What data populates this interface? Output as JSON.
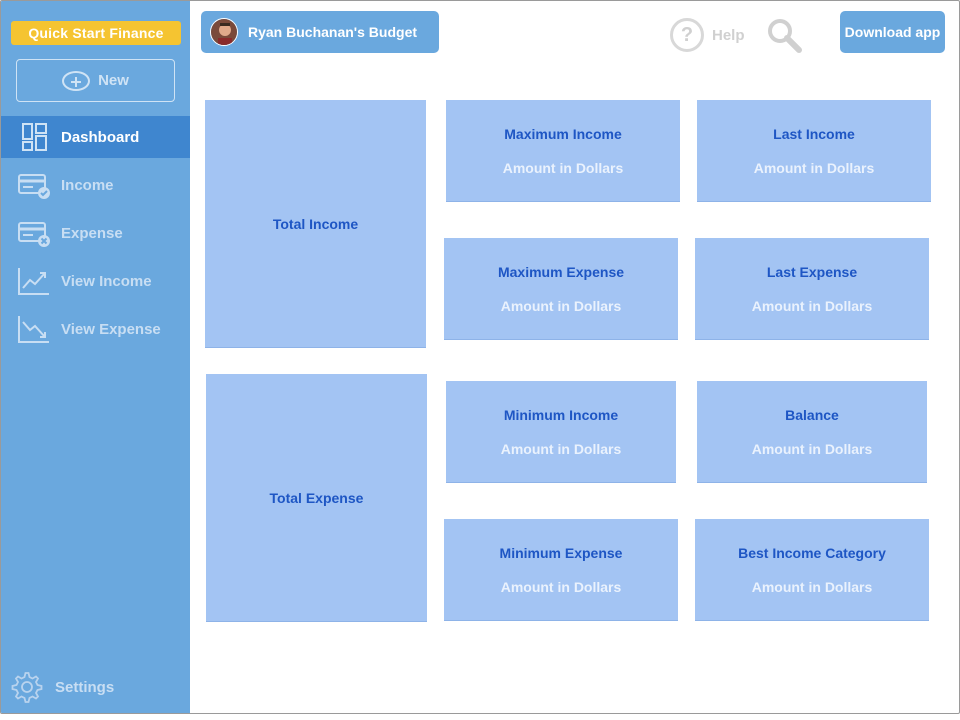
{
  "sidebar": {
    "brand": "Quick Start Finance",
    "new_label": "New",
    "items": [
      {
        "label": "Dashboard",
        "icon": "dashboard-icon"
      },
      {
        "label": "Income",
        "icon": "income-icon"
      },
      {
        "label": "Expense",
        "icon": "expense-icon"
      },
      {
        "label": "View Income",
        "icon": "chart-up-icon"
      },
      {
        "label": "View Expense",
        "icon": "chart-down-icon"
      }
    ],
    "settings_label": "Settings"
  },
  "header": {
    "budget_title": "Ryan Buchanan's Budget",
    "help_label": "Help",
    "download_label": "Download app"
  },
  "cards": {
    "total_income": "Total Income",
    "total_expense": "Total Expense",
    "max_income": {
      "title": "Maximum Income",
      "value": "Amount in Dollars"
    },
    "last_income": {
      "title": "Last Income",
      "value": "Amount in Dollars"
    },
    "max_expense": {
      "title": "Maximum Expense",
      "value": "Amount in Dollars"
    },
    "last_expense": {
      "title": "Last Expense",
      "value": "Amount in Dollars"
    },
    "min_income": {
      "title": "Minimum Income",
      "value": "Amount in Dollars"
    },
    "balance": {
      "title": "Balance",
      "value": "Amount in Dollars"
    },
    "min_expense": {
      "title": "Minimum Expense",
      "value": "Amount in Dollars"
    },
    "best_income_category": {
      "title": "Best Income Category",
      "value": "Amount in Dollars"
    }
  },
  "colors": {
    "sidebar": "#6aa8de",
    "active_nav": "#3f86cf",
    "brand": "#f5c431",
    "card": "#a3c4f3",
    "card_title": "#1e56c4"
  }
}
